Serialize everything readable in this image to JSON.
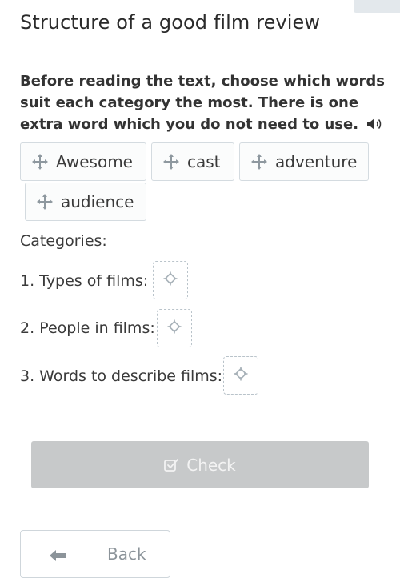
{
  "page": {
    "title": "Structure of a good film review",
    "instructions": "Before reading the text, choose which words suit each category the most. There is one extra word which you do not need to use."
  },
  "icons": {
    "speaker": "speaker-icon",
    "move": "move-arrows-icon",
    "target": "crosshair-target-icon",
    "check": "checkbox-icon",
    "back": "arrow-left-icon"
  },
  "chips": [
    {
      "label": "Awesome"
    },
    {
      "label": "cast"
    },
    {
      "label": "adventure"
    },
    {
      "label": "audience"
    }
  ],
  "categories": {
    "heading": "Categories:",
    "items": [
      {
        "label": "1. Types of films:"
      },
      {
        "label": "2. People in films:"
      },
      {
        "label": "3. Words to describe films:"
      }
    ]
  },
  "buttons": {
    "check_label": "Check",
    "back_label": "Back"
  },
  "colors": {
    "check_button_bg": "#c7c9ca",
    "chip_border": "#d4dbe0",
    "icon_gray": "#8e989f"
  }
}
